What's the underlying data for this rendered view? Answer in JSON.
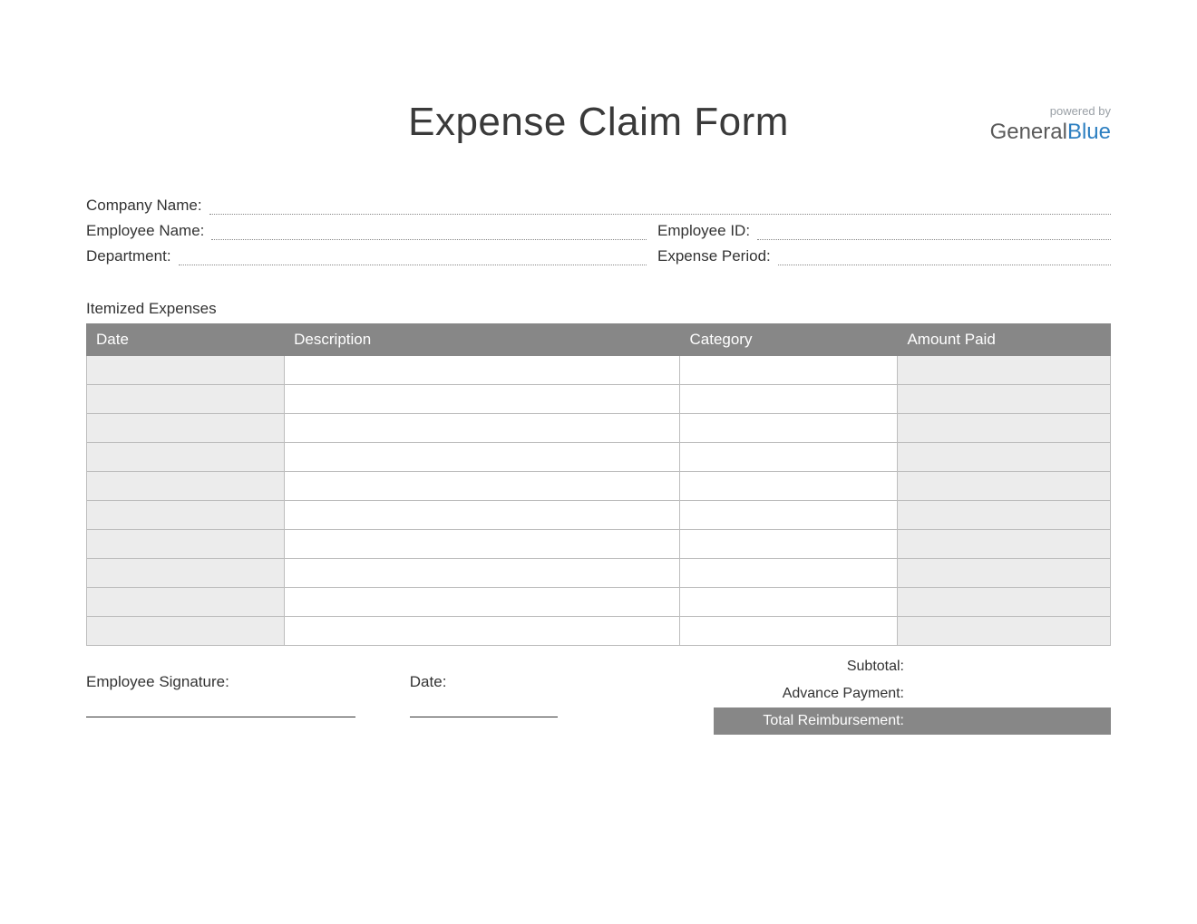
{
  "title": "Expense Claim Form",
  "branding": {
    "powered_by": "powered by",
    "name_part1": "General",
    "name_part2": "Blue"
  },
  "info": {
    "company_label": "Company Name:",
    "employee_label": "Employee Name:",
    "employee_id_label": "Employee ID:",
    "department_label": "Department:",
    "expense_period_label": "Expense Period:"
  },
  "section_title": "Itemized Expenses",
  "table": {
    "headers": {
      "date": "Date",
      "description": "Description",
      "category": "Category",
      "amount": "Amount Paid"
    },
    "row_count": 10
  },
  "totals": {
    "subtotal_label": "Subtotal:",
    "advance_label": "Advance Payment:",
    "reimbursement_label": "Total Reimbursement:"
  },
  "signature": {
    "employee_label": "Employee Signature:",
    "date_label": "Date:"
  }
}
